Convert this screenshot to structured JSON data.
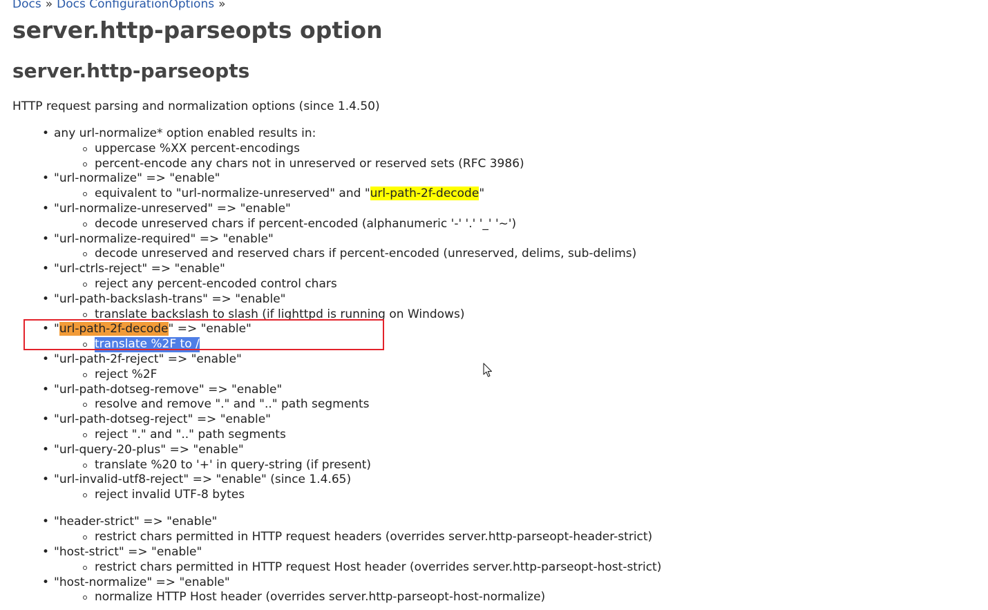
{
  "breadcrumb": {
    "items": [
      "Docs",
      "Docs ConfigurationOptions"
    ],
    "separator": "»"
  },
  "title": "server.http-parseopts option",
  "section_title": "server.http-parseopts",
  "intro": "HTTP request parsing and normalization options (since 1.4.50)",
  "lines": {
    "l0": "any url-normalize* option enabled results in:",
    "l1": "uppercase %XX percent-encodings",
    "l2": "percent-encode any chars not in unreserved or reserved sets (RFC 3986)",
    "l3": "\"url-normalize\" => \"enable\"",
    "l4_pre": "equivalent to \"url-normalize-unreserved\" and \"",
    "l4_hl": "url-path-2f-decode",
    "l4_post": "\"",
    "l5": "\"url-normalize-unreserved\" => \"enable\"",
    "l6": "decode unreserved chars if percent-encoded (alphanumeric '-' '.' '_' '~')",
    "l7": "\"url-normalize-required\" => \"enable\"",
    "l8": "decode unreserved and reserved chars if percent-encoded (unreserved, delims, sub-delims)",
    "l9": "\"url-ctrls-reject\" => \"enable\"",
    "l10": "reject any percent-encoded control chars",
    "l11": "\"url-path-backslash-trans\" => \"enable\"",
    "l12": "translate backslash to slash (if lighttpd is running on Windows)",
    "l13_pre": "\"",
    "l13_hl": "url-path-2f-decode",
    "l13_post": "\" => \"enable\"",
    "l14": "translate %2F to /",
    "l15": "\"url-path-2f-reject\" => \"enable\"",
    "l16": "reject %2F",
    "l17": "\"url-path-dotseg-remove\" => \"enable\"",
    "l18": "resolve and remove \".\" and \"..\" path segments",
    "l19": "\"url-path-dotseg-reject\" => \"enable\"",
    "l20": "reject \".\" and \"..\" path segments",
    "l21": "\"url-query-20-plus\" => \"enable\"",
    "l22": "translate %20 to '+' in query-string (if present)",
    "l23": "\"url-invalid-utf8-reject\" => \"enable\" (since 1.4.65)",
    "l24": "reject invalid UTF-8 bytes",
    "l25": "\"header-strict\" => \"enable\"",
    "l26": "restrict chars permitted in HTTP request headers (overrides server.http-parseopt-header-strict)",
    "l27": "\"host-strict\" => \"enable\"",
    "l28": "restrict chars permitted in HTTP request Host header (overrides server.http-parseopt-host-strict)",
    "l29": "\"host-normalize\" => \"enable\"",
    "l30": "normalize HTTP Host header (overrides server.http-parseopt-host-normalize)"
  },
  "colors": {
    "link": "#2a5aa8",
    "highlight_yellow": "#ffff00",
    "highlight_orange": "#f29b38",
    "selection": "#4e7ee6",
    "annotation_box": "#e3222a"
  },
  "icons": {
    "cursor": "mouse-pointer-icon"
  }
}
